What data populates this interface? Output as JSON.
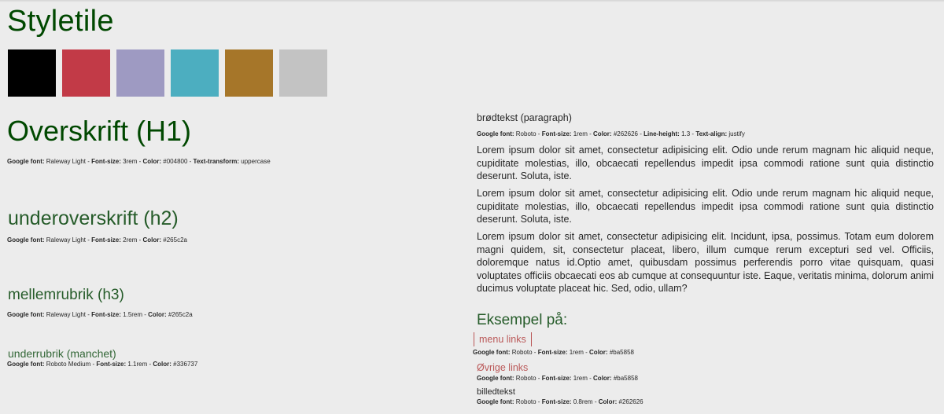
{
  "title": "Styletile",
  "colors": [
    "#000000",
    "#c23a47",
    "#9e9ac2",
    "#4caec0",
    "#a67629",
    "#c3c3c3"
  ],
  "h1": {
    "text": "Overskrift (H1)",
    "spec": [
      {
        "label": "Google font:",
        "value": "Raleway Light"
      },
      {
        "label": "Font-size:",
        "value": "3rem"
      },
      {
        "label": "Color:",
        "value": "#004800"
      },
      {
        "label": "Text-transform:",
        "value": "uppercase"
      }
    ]
  },
  "h2": {
    "text": "underoverskrift (h2)",
    "spec": [
      {
        "label": "Google font:",
        "value": "Raleway Light"
      },
      {
        "label": "Font-size:",
        "value": "2rem"
      },
      {
        "label": "Color:",
        "value": "#265c2a"
      }
    ]
  },
  "h3": {
    "text": "mellemrubrik (h3)",
    "spec": [
      {
        "label": "Google font:",
        "value": "Raleway Light"
      },
      {
        "label": "Font-size:",
        "value": "1.5rem"
      },
      {
        "label": "Color:",
        "value": "#265c2a"
      }
    ]
  },
  "h4": {
    "text": "underrubrik (manchet)",
    "spec": [
      {
        "label": "Google font:",
        "value": "Roboto Medium"
      },
      {
        "label": "Font-size:",
        "value": "1.1rem"
      },
      {
        "label": "Color:",
        "value": "#336737"
      }
    ]
  },
  "paragraph": {
    "heading": "brødtekst (paragraph)",
    "spec": [
      {
        "label": "Google font:",
        "value": "Roboto"
      },
      {
        "label": "Font-size:",
        "value": "1rem"
      },
      {
        "label": "Color:",
        "value": "#262626"
      },
      {
        "label": "Line-height:",
        "value": "1.3"
      },
      {
        "label": "Text-align:",
        "value": "justify"
      }
    ],
    "texts": [
      "Lorem ipsum dolor sit amet, consectetur adipisicing elit. Odio unde rerum magnam hic aliquid neque, cupiditate molestias, illo, obcaecati repellendus impedit ipsa commodi ratione sunt quia distinctio deserunt. Soluta, iste.",
      "Lorem ipsum dolor sit amet, consectetur adipisicing elit. Odio unde rerum magnam hic aliquid neque, cupiditate molestias, illo, obcaecati repellendus impedit ipsa commodi ratione sunt quia distinctio deserunt. Soluta, iste.",
      "Lorem ipsum dolor sit amet, consectetur adipisicing elit. Incidunt, ipsa, possimus. Totam eum dolorem magni quidem, sit, consectetur placeat, libero, illum cumque rerum excepturi sed vel. Officiis, doloremque natus id.Optio amet, quibusdam possimus perferendis porro vitae quisquam, quasi voluptates officiis obcaecati eos ab cumque at consequuntur iste. Eaque, veritatis minima, dolorum animi ducimus voluptate placeat hic. Sed, odio, ullam?"
    ]
  },
  "example": {
    "heading": "Eksempel på:",
    "menu_link": "menu links",
    "menu_spec": [
      {
        "label": "Google font:",
        "value": "Roboto"
      },
      {
        "label": "Font-size:",
        "value": "1rem"
      },
      {
        "label": "Color:",
        "value": "#ba5858"
      }
    ],
    "other_link": "Øvrige links",
    "other_spec": [
      {
        "label": "Google font:",
        "value": "Roboto"
      },
      {
        "label": "Font-size:",
        "value": "1rem"
      },
      {
        "label": "Color:",
        "value": "#ba5858"
      }
    ],
    "caption": "billedtekst",
    "caption_spec": [
      {
        "label": "Google font:",
        "value": "Roboto"
      },
      {
        "label": "Font-size:",
        "value": "0.8rem"
      },
      {
        "label": "Color:",
        "value": "#262626"
      }
    ]
  }
}
